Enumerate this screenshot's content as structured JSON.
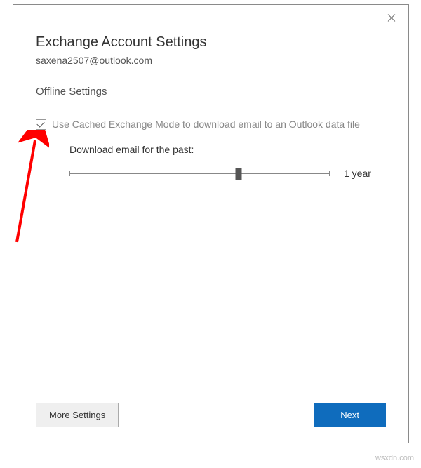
{
  "dialog": {
    "title": "Exchange Account Settings",
    "email": "saxena2507@outlook.com",
    "section_heading": "Offline Settings",
    "cached_mode_label": "Use Cached Exchange Mode to download email to an Outlook data file",
    "cached_mode_checked": true,
    "download_label": "Download email for the past:",
    "slider_value_label": "1 year",
    "more_settings_label": "More Settings",
    "next_label": "Next"
  },
  "watermark": "wsxdn.com",
  "colors": {
    "primary": "#0f6cbd",
    "annotation": "#ff0000"
  }
}
